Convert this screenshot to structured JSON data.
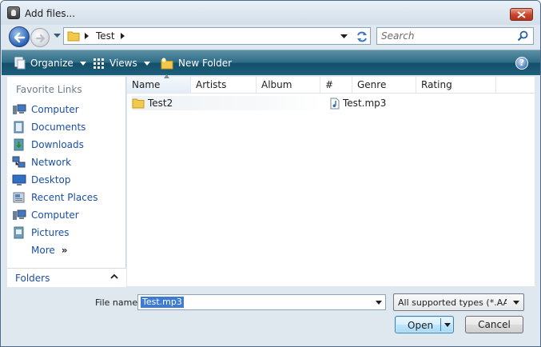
{
  "window": {
    "title": "Add files..."
  },
  "address": {
    "path": [
      "Test"
    ]
  },
  "search": {
    "placeholder": "Search"
  },
  "toolbar": {
    "organize": "Organize",
    "views": "Views",
    "new_folder": "New Folder"
  },
  "nav": {
    "favorites_header": "Favorite Links",
    "items": [
      {
        "label": "Computer",
        "icon": "computer-icon"
      },
      {
        "label": "Documents",
        "icon": "documents-icon"
      },
      {
        "label": "Downloads",
        "icon": "downloads-icon"
      },
      {
        "label": "Network",
        "icon": "network-icon"
      },
      {
        "label": "Desktop",
        "icon": "desktop-icon"
      },
      {
        "label": "Recent Places",
        "icon": "recent-places-icon"
      },
      {
        "label": "Computer",
        "icon": "computer-icon"
      },
      {
        "label": "Pictures",
        "icon": "pictures-icon"
      }
    ],
    "more": "More",
    "folders": "Folders"
  },
  "columns": [
    "Name",
    "Artists",
    "Album",
    "#",
    "Genre",
    "Rating"
  ],
  "files": [
    {
      "name": "Test2",
      "type": "folder"
    },
    {
      "name": "Test.mp3",
      "type": "audio"
    }
  ],
  "bottom": {
    "filename_label": "File name:",
    "filename_value": "Test.mp3",
    "filetype_value": "All supported types (*.AAC;*.A",
    "open": "Open",
    "cancel": "Cancel"
  },
  "colors": {
    "toolbar": "#1d5f7b",
    "link": "#1a4fa3",
    "selection": "#3d7bd5"
  }
}
